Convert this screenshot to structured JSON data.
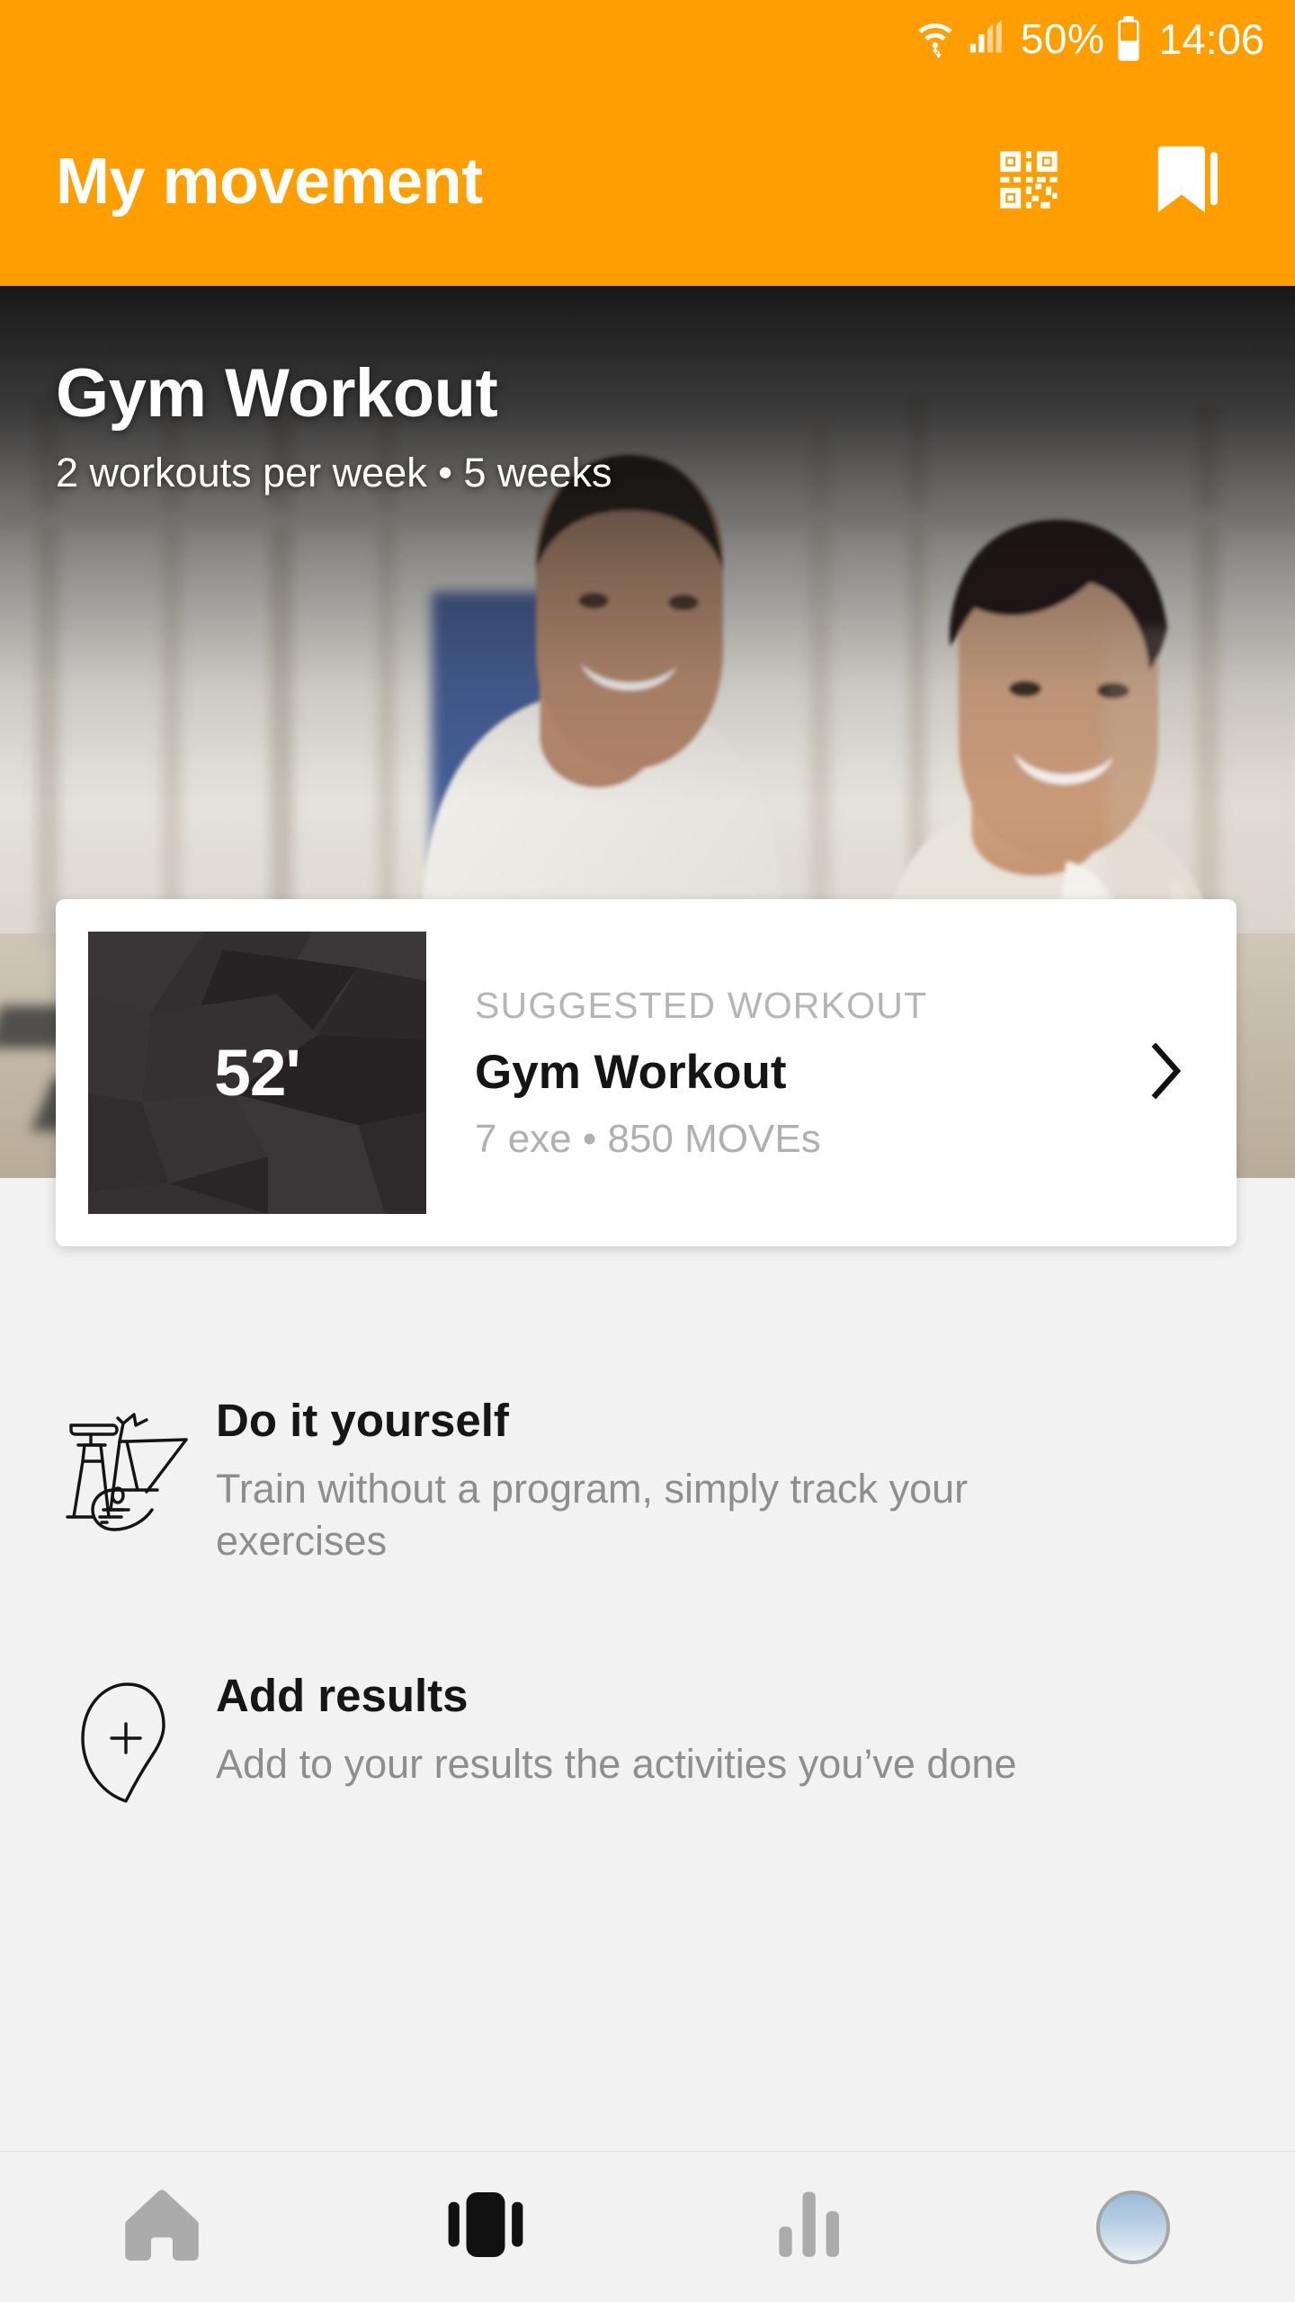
{
  "status_bar": {
    "wifi_icon": "wifi-icon",
    "signal_icon": "cellular-signal-icon",
    "battery_percent": "50%",
    "battery_icon": "battery-icon",
    "time": "14:06"
  },
  "app_bar": {
    "title": "My movement",
    "background_color": "#ff9e00",
    "actions": [
      {
        "name": "qr-scan-button",
        "icon": "qr-code-icon"
      },
      {
        "name": "bookmarks-button",
        "icon": "bookmarks-icon"
      }
    ]
  },
  "hero": {
    "title": "Gym Workout",
    "subtitle": "2 workouts per week • 5 weeks",
    "image_alt": "gym-photo"
  },
  "suggested_card": {
    "duration": "52'",
    "kicker": "SUGGESTED WORKOUT",
    "title": "Gym Workout",
    "meta": "7 exe • 850 MOVEs",
    "chevron_icon": "chevron-right-icon"
  },
  "actions": [
    {
      "icon": "exercise-bike-icon",
      "title": "Do it yourself",
      "description": "Train without a program, simply track your exercises"
    },
    {
      "icon": "add-location-icon",
      "title": "Add results",
      "description": "Add to your results the activities you’ve done"
    }
  ],
  "bottom_nav": {
    "items": [
      {
        "name": "nav-home",
        "icon": "home-icon",
        "active": false
      },
      {
        "name": "nav-movement",
        "icon": "movement-icon",
        "active": true
      },
      {
        "name": "nav-stats",
        "icon": "bar-chart-icon",
        "active": false
      },
      {
        "name": "nav-profile",
        "icon": "avatar-icon",
        "active": false
      }
    ],
    "inactive_color": "#ababab",
    "active_color": "#111111"
  }
}
